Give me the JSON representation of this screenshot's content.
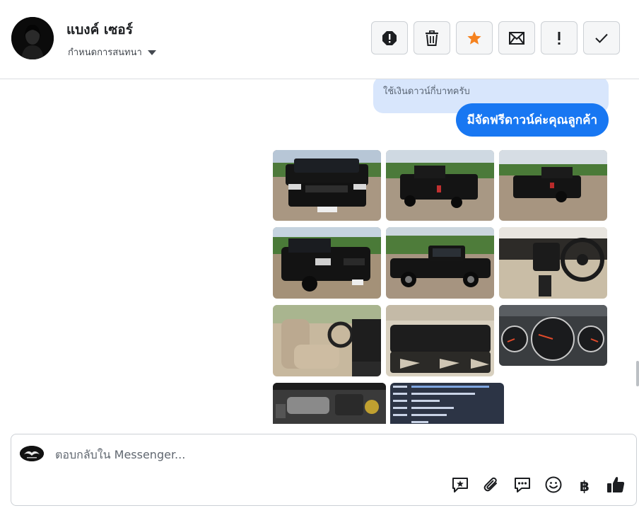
{
  "header": {
    "name": "แบงค์ เซอร์",
    "subtitle": "กำหนดการสนทนา",
    "actions": [
      {
        "icon": "report-icon"
      },
      {
        "icon": "trash-icon"
      },
      {
        "icon": "star-icon",
        "color": "#f5821f"
      },
      {
        "icon": "envelope-icon"
      },
      {
        "icon": "exclamation-icon"
      },
      {
        "icon": "check-icon"
      }
    ]
  },
  "thread": {
    "quote_text": "ใช้เงินดาวน์กี่บาทครับ",
    "reply_text": "มีจัดฟรีดาวน์ค่ะคุณลูกค้า",
    "reply_color": "#1877f2",
    "photos": [
      {
        "name": "truck-front-photo"
      },
      {
        "name": "truck-rear-photo"
      },
      {
        "name": "truck-rear-angle-photo"
      },
      {
        "name": "truck-front-angle-photo"
      },
      {
        "name": "truck-side-photo"
      },
      {
        "name": "dashboard-photo"
      },
      {
        "name": "seats-photo"
      },
      {
        "name": "rear-seat-photo"
      },
      {
        "name": "gauge-cluster-photo"
      },
      {
        "name": "engine-bay-photo"
      },
      {
        "name": "registration-document-photo"
      }
    ]
  },
  "composer": {
    "placeholder": "ตอบกลับใน Messenger...",
    "tools": [
      {
        "icon": "saved-reply-icon"
      },
      {
        "icon": "paperclip-icon"
      },
      {
        "icon": "chat-bubble-icon"
      },
      {
        "icon": "emoji-icon"
      },
      {
        "icon": "baht-icon",
        "label": "฿"
      },
      {
        "icon": "thumbs-up-icon"
      }
    ]
  }
}
